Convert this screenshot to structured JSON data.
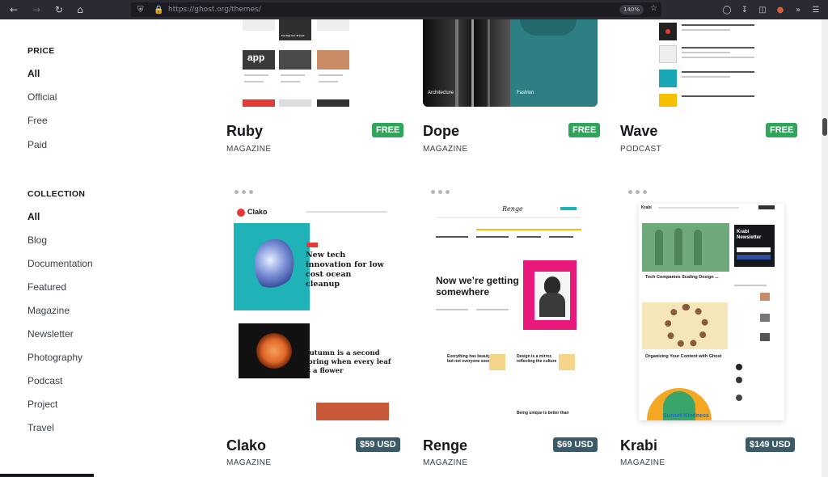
{
  "browser": {
    "url": "https://ghost.org/themes/",
    "zoom": "140%"
  },
  "sidebar": {
    "price_heading": "PRICE",
    "price_items": [
      "All",
      "Official",
      "Free",
      "Paid"
    ],
    "collection_heading": "COLLECTION",
    "collection_items": [
      "All",
      "Blog",
      "Documentation",
      "Featured",
      "Magazine",
      "Newsletter",
      "Photography",
      "Podcast",
      "Project",
      "Travel"
    ]
  },
  "themes": [
    {
      "name": "Ruby",
      "category": "MAGAZINE",
      "price": "FREE"
    },
    {
      "name": "Dope",
      "category": "MAGAZINE",
      "price": "FREE"
    },
    {
      "name": "Wave",
      "category": "PODCAST",
      "price": "FREE"
    },
    {
      "name": "Clako",
      "category": "MAGAZINE",
      "price": "$59 USD"
    },
    {
      "name": "Renge",
      "category": "MAGAZINE",
      "price": "$69 USD"
    },
    {
      "name": "Krabi",
      "category": "MAGAZINE",
      "price": "$149 USD"
    }
  ],
  "previews": {
    "ruby": {
      "tile_app": "app",
      "caption": "Facing for Travel"
    },
    "dope": {
      "label_left": "Architecture",
      "label_right": "Fashion"
    },
    "clako": {
      "logo": "Clako",
      "headline1": "New tech innovation for low cost ocean cleanup",
      "headline2": "Autumn is a second spring when every leaf is a flower"
    },
    "renge": {
      "logo": "Renge",
      "headline": "Now we’re getting somewhere",
      "col1": "Everything has beauty, but not everyone sees it",
      "col2": "Design is a mirror, reflecting the culture",
      "col3": "Being unique is better than"
    },
    "krabi": {
      "logo": "Krabi",
      "newsletter": "Krabi Newsletter",
      "headline1": "Tech Companies Scaling Design ...",
      "headline2": "Organizing Your Content with Ghost",
      "tag": "Sunset Kindness"
    }
  },
  "colors": {
    "free_badge": "#30a45b",
    "paid_badge": "#3a5a68",
    "clako_teal": "#1fb3b8",
    "renge_pink": "#e8197a",
    "krabi_green": "#6fa97b"
  }
}
